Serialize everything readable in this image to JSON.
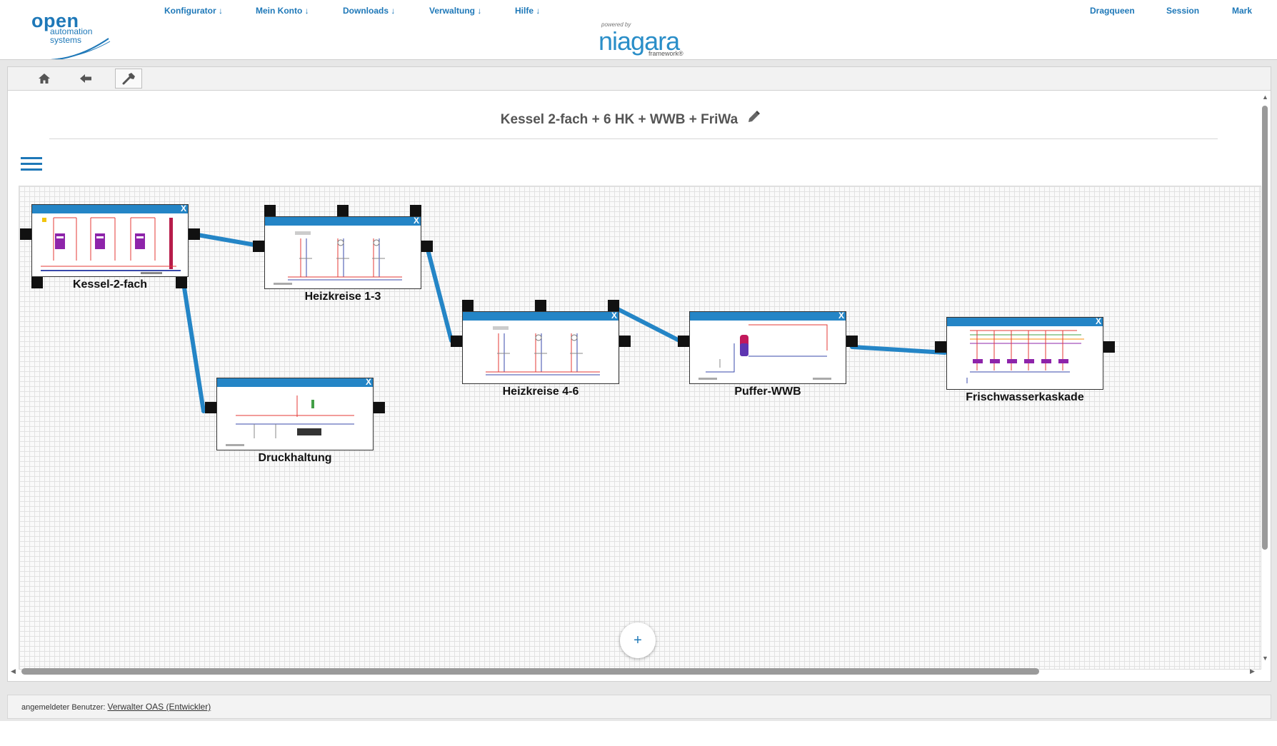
{
  "brand": {
    "logo_open": "open",
    "logo_automation": "automation",
    "logo_systems": "systems",
    "powered_by": "powered by",
    "niagara": "niagara",
    "framework": "framework®",
    "accent": "#1e78b8"
  },
  "nav": {
    "konfigurator": "Konfigurator ↓",
    "mein_konto": "Mein Konto ↓",
    "downloads": "Downloads ↓",
    "verwaltung": "Verwaltung ↓",
    "hilfe": "Hilfe ↓",
    "dragqueen": "Dragqueen",
    "session": "Session",
    "mark": "Mark"
  },
  "toolbar": {
    "icons": [
      "home-icon",
      "back-arrow-icon",
      "wrench-icon"
    ]
  },
  "page": {
    "title": "Kessel 2-fach + 6 HK + WWB + FriWa"
  },
  "canvas": {
    "nodes": [
      {
        "label": "Kessel-2-fach",
        "close": "X"
      },
      {
        "label": "Heizkreise 1-3",
        "close": "X"
      },
      {
        "label": "Druckhaltung",
        "close": "X"
      },
      {
        "label": "Heizkreise 4-6",
        "close": "X"
      },
      {
        "label": "Puffer-WWB",
        "close": "X"
      },
      {
        "label": "Frischwasserkaskade",
        "close": "X"
      }
    ],
    "add_label": "+",
    "link_color": "#2485c6"
  },
  "footer": {
    "label": "angemeldeter Benutzer:",
    "user": "Verwalter OAS (Entwickler)"
  }
}
